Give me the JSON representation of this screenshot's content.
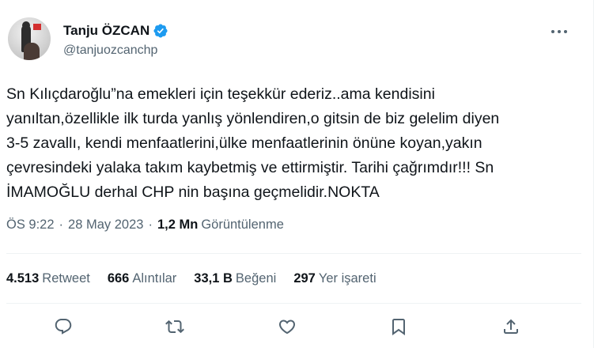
{
  "author": {
    "display_name": "Tanju ÖZCAN",
    "handle": "@tanjuozcanchp",
    "verified": true
  },
  "tweet": {
    "text": "Sn Kılıçdaroğlu”na emekleri için teşekkür ederiz..ama kendisini\nyanıltan,özellikle ilk turda yanlış yönlendiren,o gitsin de biz gelelim diyen\n3-5 zavallı, kendi menfaatlerini,ülke menfaatlerinin önüne koyan,yakın\nçevresindeki yalaka takım kaybetmiş ve ettirmiştir. Tarihi çağrımdır!!! Sn\nİMAMOĞLU derhal CHP nin başına geçmelidir.NOKTA"
  },
  "meta": {
    "time": "ÖS 9:22",
    "separator": "·",
    "date": "28 May 2023",
    "views_count": "1,2 Mn",
    "views_label": "Görüntülenme"
  },
  "stats": [
    {
      "count": "4.513",
      "label": "Retweet"
    },
    {
      "count": "666",
      "label": "Alıntılar"
    },
    {
      "count": "33,1 B",
      "label": "Beğeni"
    },
    {
      "count": "297",
      "label": "Yer işareti"
    }
  ],
  "icons": {
    "verified": "verified-badge-icon",
    "more": "more-options-icon",
    "reply": "reply-icon",
    "retweet": "retweet-icon",
    "like": "heart-icon",
    "bookmark": "bookmark-icon",
    "share": "share-icon"
  },
  "colors": {
    "primary_text": "#0f1419",
    "secondary_text": "#536471",
    "verified_blue": "#1d9bf0",
    "divider": "#eff3f4"
  }
}
